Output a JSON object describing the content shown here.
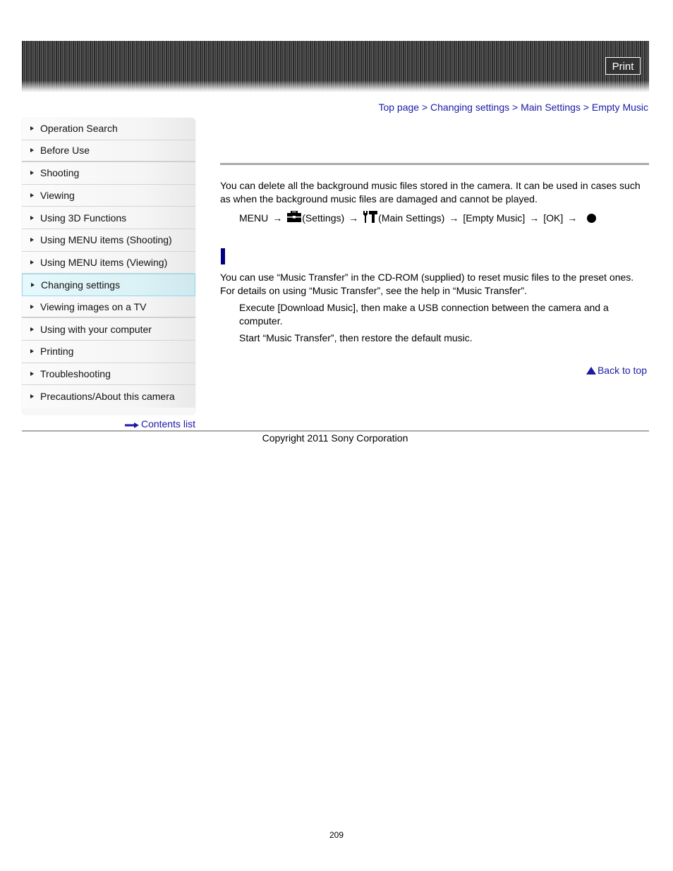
{
  "header": {
    "print_label": "Print"
  },
  "breadcrumb": {
    "items": [
      "Top page",
      "Changing settings",
      "Main Settings",
      "Empty Music"
    ],
    "separator": ">"
  },
  "sidebar": {
    "items": [
      {
        "label": "Operation Search"
      },
      {
        "label": "Before Use"
      },
      {
        "label": "Shooting"
      },
      {
        "label": "Viewing"
      },
      {
        "label": "Using 3D Functions"
      },
      {
        "label": "Using MENU items (Shooting)"
      },
      {
        "label": "Using MENU items (Viewing)"
      },
      {
        "label": "Changing settings",
        "active": true
      },
      {
        "label": "Viewing images on a TV"
      },
      {
        "label": "Using with your computer"
      },
      {
        "label": "Printing"
      },
      {
        "label": "Troubleshooting"
      },
      {
        "label": "Precautions/About this camera"
      }
    ],
    "contents_link": "Contents list"
  },
  "main": {
    "intro": "You can delete all the background music files stored in the camera. It can be used in cases such as when the background music files are damaged and cannot be played.",
    "menu_path": {
      "menu": "MENU",
      "arrow": "→",
      "settings_icon": "toolbox-icon",
      "settings": "(Settings)",
      "main_settings_icon": "tools-icon",
      "main_settings": "(Main Settings)",
      "empty_music": "[Empty Music]",
      "ok": "[OK]",
      "center_button_icon": "center-button-icon"
    },
    "restore_text": "You can use “Music Transfer” in the CD-ROM (supplied) to reset music files to the preset ones. For details on using “Music Transfer”, see the help in “Music Transfer”.",
    "steps": [
      "Execute [Download Music], then make a USB connection between the camera and a computer.",
      "Start “Music Transfer”, then restore the default music."
    ],
    "back_to_top": "Back to top"
  },
  "footer": {
    "copyright": "Copyright 2011 Sony Corporation",
    "page_number": "209"
  },
  "colors": {
    "link": "#1a1aa6",
    "section_marker": "#000080",
    "active_nav_bg": "#daf1f5",
    "active_nav_border": "#8fdbef"
  }
}
